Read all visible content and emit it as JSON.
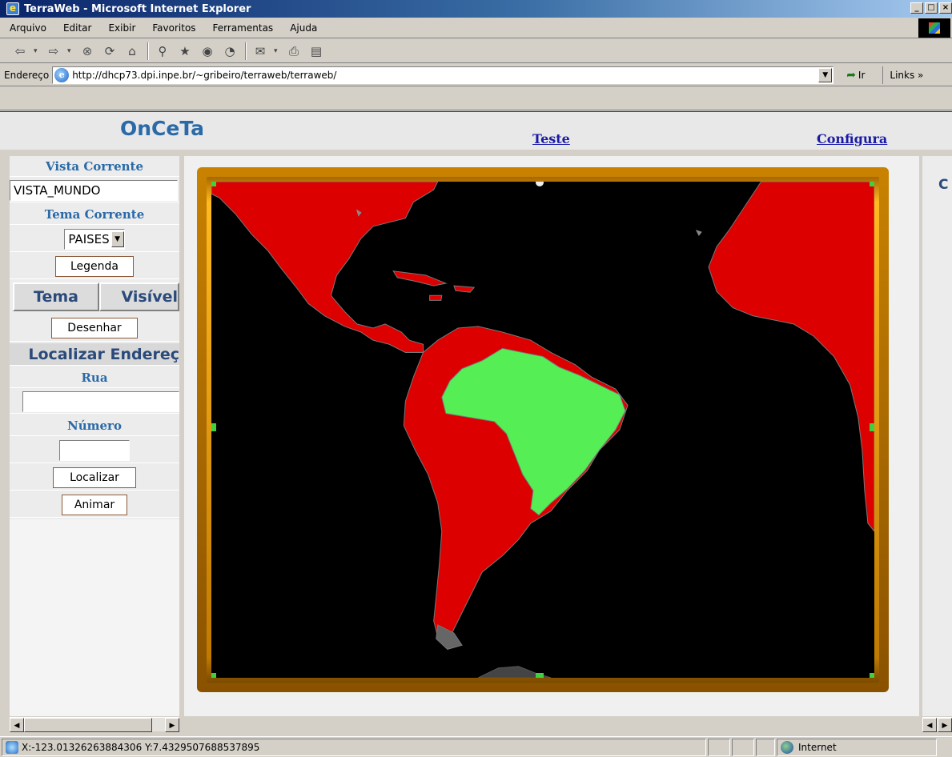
{
  "window": {
    "title": "TerraWeb - Microsoft Internet Explorer",
    "buttons": [
      "_",
      "□",
      "×"
    ]
  },
  "menu": [
    "Arquivo",
    "Editar",
    "Exibir",
    "Favoritos",
    "Ferramentas",
    "Ajuda"
  ],
  "toolbar": {
    "icons": [
      "back-icon",
      "forward-icon",
      "stop-icon",
      "refresh-icon",
      "home-icon",
      "search-icon",
      "favorites-icon",
      "history-icon",
      "media-icon",
      "mail-icon",
      "print-icon",
      "edit-icon"
    ]
  },
  "address": {
    "label": "Endereço",
    "url": "http://dhcp73.dpi.inpe.br/~gribeiro/terraweb/terraweb/",
    "go_label": "Ir",
    "links_label": "Links »"
  },
  "header": {
    "brand": "OnCeTa",
    "links": [
      "Teste",
      "Configura"
    ]
  },
  "left_panel": {
    "vista_title": "Vista Corrente",
    "vista_value": "VISTA_MUNDO",
    "tema_title": "Tema Corrente",
    "tema_value": "PAISES",
    "legenda_button": "Legenda",
    "tab_tema": "Tema",
    "tab_visivel": "Visível",
    "desenhar_button": "Desenhar",
    "localizar_title": "Localizar Endereç",
    "rua_label": "Rua",
    "rua_value": "",
    "numero_label": "Número",
    "numero_value": "",
    "localizar_button": "Localizar",
    "animar_button": "Animar"
  },
  "right_panel": {
    "text": "C"
  },
  "map": {
    "land_color": "#dd0000",
    "highlight_color": "#55ee55",
    "ocean_color": "#000000",
    "frame_color": "#c07a00"
  },
  "status": {
    "text": "X:-123.01326263884306 Y:7.4329507688537895",
    "zone": "Internet"
  }
}
